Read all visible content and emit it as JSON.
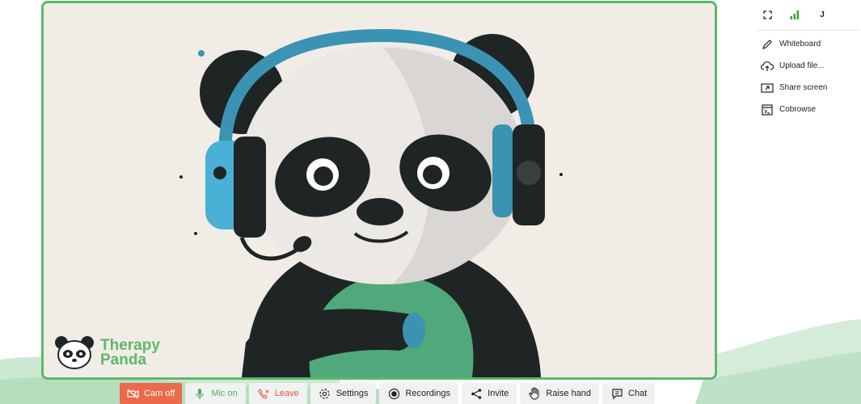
{
  "brand": {
    "line1": "Therapy",
    "line2": "Panda",
    "color": "#5cb86a"
  },
  "top_bar": {
    "user_initial": "J",
    "signal_color": "#3aa33a"
  },
  "side_menu": {
    "items": [
      {
        "label": "Whiteboard",
        "icon": "pencil-icon"
      },
      {
        "label": "Upload file...",
        "icon": "cloud-upload-icon"
      },
      {
        "label": "Share screen",
        "icon": "share-screen-icon"
      },
      {
        "label": "Cobrowse",
        "icon": "browser-window-icon"
      }
    ]
  },
  "controls": {
    "cam": {
      "label": "Cam off",
      "icon": "camera-off-icon",
      "color": "#ea6a4a"
    },
    "mic": {
      "label": "Mic on",
      "icon": "microphone-icon",
      "color": "#4fae5a"
    },
    "leave": {
      "label": "Leave",
      "icon": "phone-hangup-icon",
      "color": "#e0563e"
    },
    "settings": {
      "label": "Settings",
      "icon": "gear-icon"
    },
    "recordings": {
      "label": "Recordings",
      "icon": "record-icon"
    },
    "invite": {
      "label": "Invite",
      "icon": "share-icon"
    },
    "raise_hand": {
      "label": "Raise hand",
      "icon": "hand-icon"
    },
    "chat": {
      "label": "Chat",
      "icon": "chat-icon"
    }
  }
}
